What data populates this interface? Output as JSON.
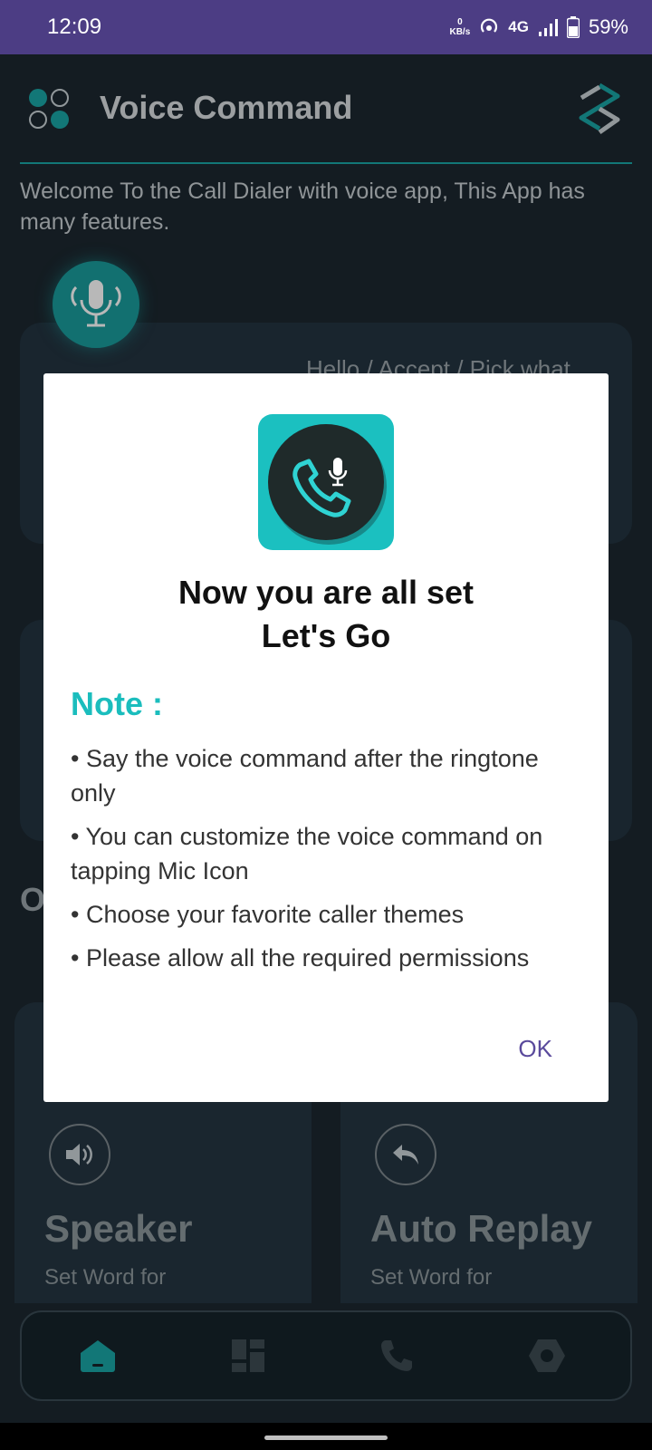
{
  "status_bar": {
    "time": "12:09",
    "data_rate_value": "0",
    "data_rate_unit": "KB/s",
    "network": "4G",
    "battery": "59%"
  },
  "app_bar": {
    "title": "Voice Command"
  },
  "welcome_text": "Welcome To the Call Dialer with voice app, This App has many features.",
  "background": {
    "card1_partial_text": "Hello / Accept / Pick what",
    "section_partial_letter": "O",
    "features": [
      {
        "title": "Speaker",
        "subtitle": "Set Word for",
        "icon": "speaker-icon"
      },
      {
        "title": "Auto Replay",
        "subtitle": "Set Word for",
        "icon": "reply-icon"
      }
    ]
  },
  "bottom_nav": {
    "items": [
      {
        "icon": "home-icon",
        "active": true
      },
      {
        "icon": "dashboard-icon",
        "active": false
      },
      {
        "icon": "phone-icon",
        "active": false
      },
      {
        "icon": "settings-icon",
        "active": false
      }
    ]
  },
  "dialog": {
    "heading_line1": "Now you are all set",
    "heading_line2": "Let's Go",
    "note_title": "Note :",
    "notes": [
      "Say the voice command after the ringtone only",
      "You can customize the voice command on tapping Mic Icon",
      "Choose your favorite caller themes",
      "Please allow all the required permissions"
    ],
    "ok_label": "OK"
  },
  "colors": {
    "accent": "#1aa5a5",
    "status_bar": "#4c3d84",
    "background": "#1c2830",
    "ok_text": "#5a4a9c"
  }
}
